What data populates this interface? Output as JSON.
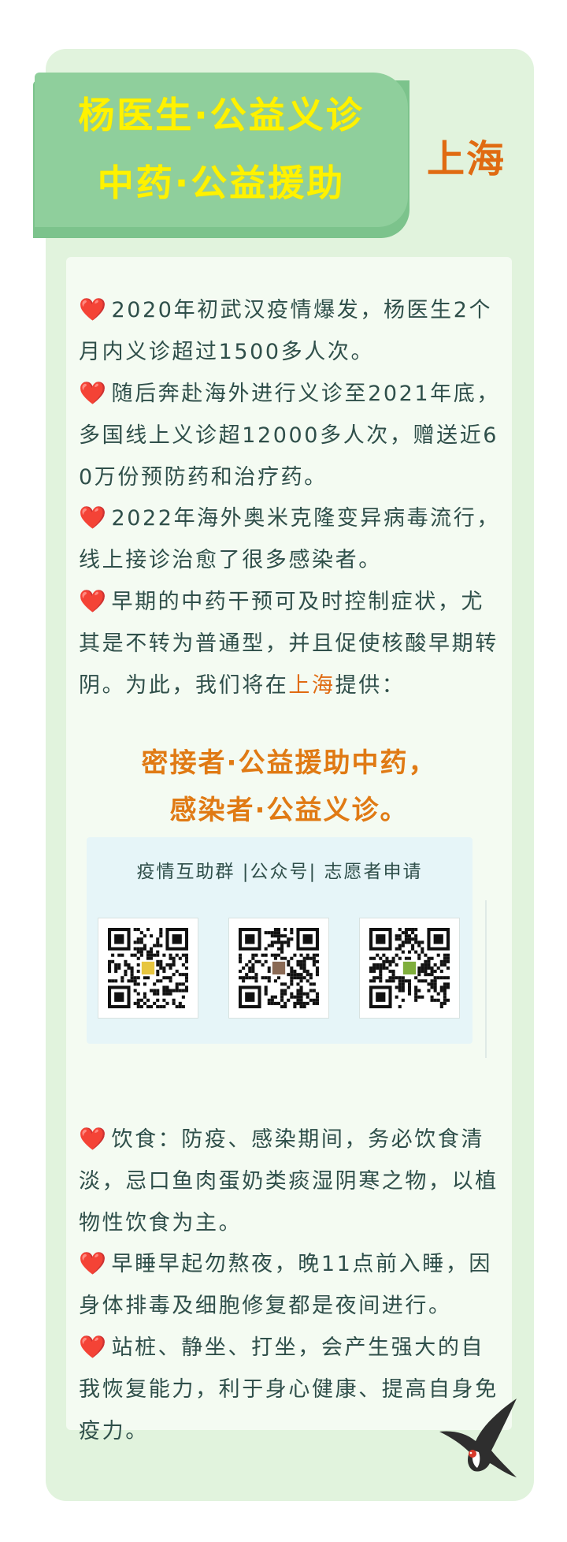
{
  "banner": {
    "line1": "杨医生·公益义诊",
    "line2": "中药·公益援助",
    "city": "上海"
  },
  "heart_icon": "❤️",
  "intro": [
    {
      "text": "2020年初武汉疫情爆发，杨医生2个月内义诊超过1500多人次。"
    },
    {
      "text": "随后奔赴海外进行义诊至2021年底，多国线上义诊超12000多人次，赠送近60万份预防药和治疗药。"
    },
    {
      "text": "2022年海外奥米克隆变异病毒流行，线上接诊治愈了很多感染者。"
    },
    {
      "text_before": "早期的中药干预可及时控制症状，尤其是不转为普通型，并且促使核酸早期转阴。为此，我们将在",
      "highlight": "上海",
      "text_after": "提供："
    }
  ],
  "slogan": {
    "line1": "密接者·公益援助中药，",
    "line2": "感染者·公益义诊。"
  },
  "qr": {
    "caption": "疫情互助群 |公众号| 志愿者申请",
    "codes": [
      {
        "icon": "qr-code-icon",
        "center_color": "#e7c640"
      },
      {
        "icon": "qr-code-icon",
        "center_color": "#8a6a55"
      },
      {
        "icon": "qr-code-icon",
        "center_color": "#7fae3c"
      }
    ]
  },
  "tips": [
    {
      "text": "饮食：防疫、感染期间，务必饮食清淡，忌口鱼肉蛋奶类痰湿阴寒之物，以植物性饮食为主。"
    },
    {
      "text": "早睡早起勿熬夜，晚11点前入睡，因身体排毒及细胞修复都是夜间进行。"
    },
    {
      "text": "站桩、静坐、打坐，会产生强大的自我恢复能力，利于身心健康、提高自身免疫力。"
    }
  ],
  "colors": {
    "banner_green": "#8fcf9c",
    "banner_text": "#fff200",
    "accent_orange": "#e06b12",
    "card_bg": "#e1f3dd",
    "body_text": "#2f4f4a",
    "heart": "#e0302b"
  }
}
